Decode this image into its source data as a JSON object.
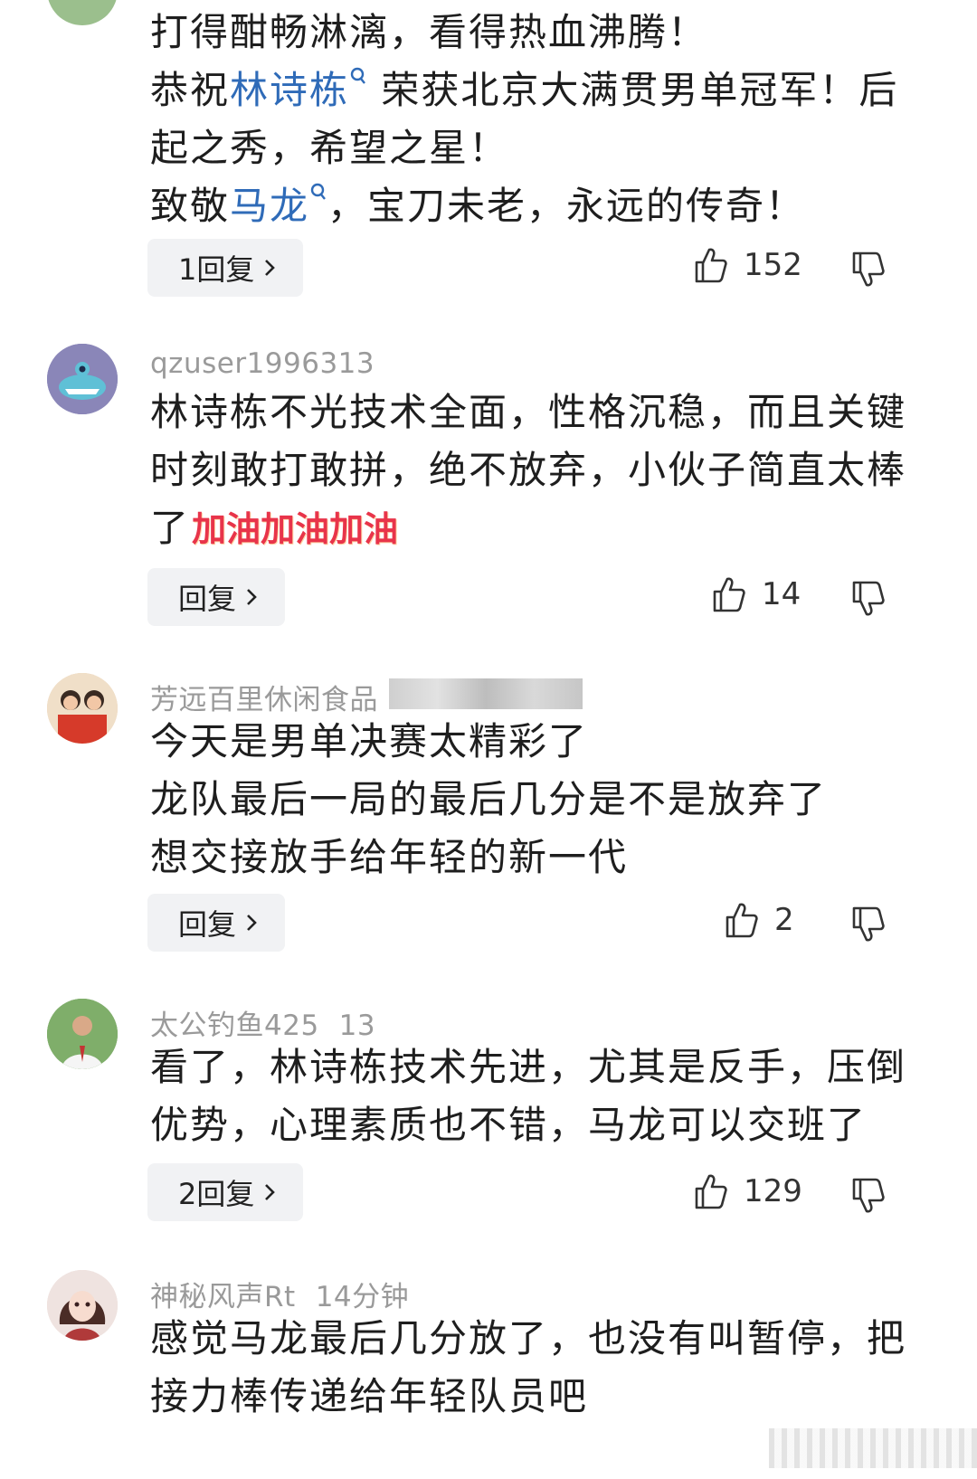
{
  "comments": [
    {
      "username": "",
      "time": "",
      "lines": [
        {
          "segments": [
            {
              "t": "打得酣畅淋漓，看得热血沸腾！"
            }
          ]
        },
        {
          "segments": [
            {
              "t": "恭祝"
            },
            {
              "t": "林诗栋",
              "mention": true
            },
            {
              "t": " 荣获北京大满贯男单冠军！后"
            }
          ]
        },
        {
          "segments": [
            {
              "t": "起之秀，希望之星！"
            }
          ]
        },
        {
          "segments": [
            {
              "t": "致敬"
            },
            {
              "t": "马龙",
              "mention": true
            },
            {
              "t": "，宝刀未老，永远的传奇！"
            }
          ]
        }
      ],
      "reply_label": "1回复",
      "likes": "152"
    },
    {
      "username": "qzuser1996313",
      "time": "",
      "lines": [
        {
          "segments": [
            {
              "t": "林诗栋不光技术全面，性格沉稳，而且关键"
            }
          ]
        },
        {
          "segments": [
            {
              "t": "时刻敢打敢拼，绝不放弃，小伙子简直太棒"
            }
          ]
        },
        {
          "segments": [
            {
              "t": "了"
            },
            {
              "t": "加油加油加油",
              "emoji": true
            }
          ]
        }
      ],
      "reply_label": "回复",
      "likes": "14"
    },
    {
      "username": "芳远百里休闲食品",
      "time": "",
      "lines": [
        {
          "segments": [
            {
              "t": "今天是男单决赛太精彩了"
            }
          ]
        },
        {
          "segments": [
            {
              "t": "龙队最后一局的最后几分是不是放弃了"
            }
          ]
        },
        {
          "segments": [
            {
              "t": "想交接放手给年轻的新一代"
            }
          ]
        }
      ],
      "reply_label": "回复",
      "likes": "2"
    },
    {
      "username": "太公钓鱼425",
      "time": "13",
      "lines": [
        {
          "segments": [
            {
              "t": "看了，林诗栋技术先进，尤其是反手，压倒"
            }
          ]
        },
        {
          "segments": [
            {
              "t": "优势，心理素质也不错，马龙可以交班了"
            }
          ]
        }
      ],
      "reply_label": "2回复",
      "likes": "129"
    },
    {
      "username": "神秘风声Rt",
      "time": "14分钟",
      "lines": [
        {
          "segments": [
            {
              "t": "感觉马龙最后几分放了，也没有叫暂停，把"
            }
          ]
        },
        {
          "segments": [
            {
              "t": "接力棒传递给年轻队员吧"
            }
          ]
        }
      ],
      "reply_label": "",
      "likes": ""
    }
  ],
  "colors": {
    "mention": "#2f6bb8",
    "meta": "#9a9a9a",
    "button_bg": "#f1f2f4"
  },
  "icons": [
    "search-icon",
    "thumbs-up-icon",
    "thumbs-down-icon",
    "chevron-right-icon"
  ]
}
